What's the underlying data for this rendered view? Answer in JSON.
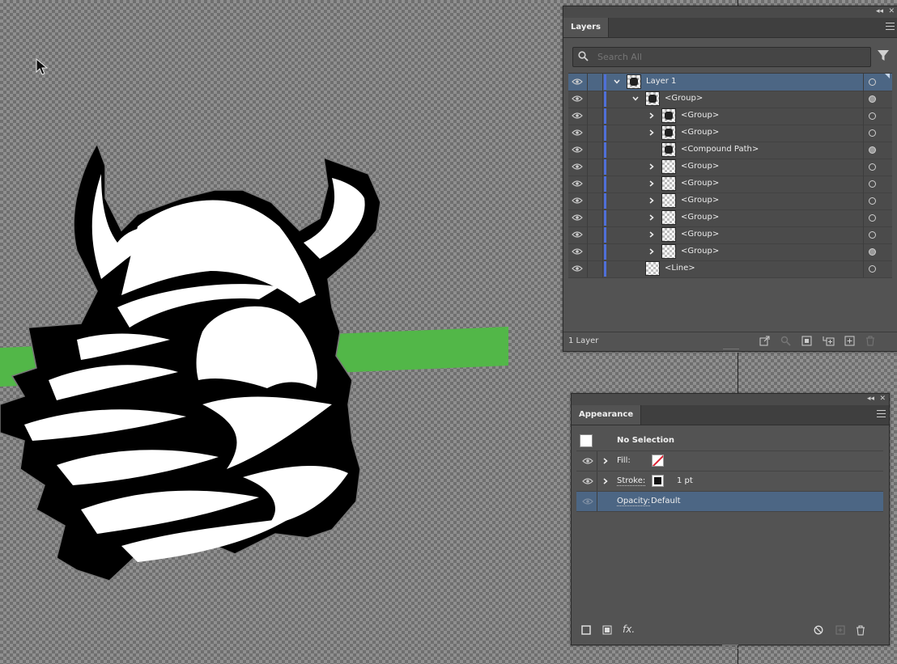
{
  "canvas": {
    "green_bar_color": "#52b748",
    "artwork_name": "viking-mascot-illustration"
  },
  "layers_panel": {
    "tab_label": "Layers",
    "search_placeholder": "Search All",
    "footer_count": "1 Layer",
    "rows": [
      {
        "label": "Layer 1",
        "expanded": true
      },
      {
        "label": "<Group>",
        "expanded": true
      },
      {
        "label": "<Group>",
        "expanded": false
      },
      {
        "label": "<Group>",
        "expanded": false
      },
      {
        "label": "<Compound Path>"
      },
      {
        "label": "<Group>",
        "expanded": false
      },
      {
        "label": "<Group>",
        "expanded": false
      },
      {
        "label": "<Group>",
        "expanded": false
      },
      {
        "label": "<Group>",
        "expanded": false
      },
      {
        "label": "<Group>",
        "expanded": false
      },
      {
        "label": "<Group>",
        "expanded": false
      },
      {
        "label": "<Line>"
      }
    ],
    "layer_color": "#4f6fd8"
  },
  "appearance_panel": {
    "tab_label": "Appearance",
    "selection_label": "No Selection",
    "fill_label": "Fill:",
    "stroke_label": "Stroke:",
    "stroke_weight": "1 pt",
    "opacity_label": "Opacity:",
    "opacity_value": "Default"
  }
}
